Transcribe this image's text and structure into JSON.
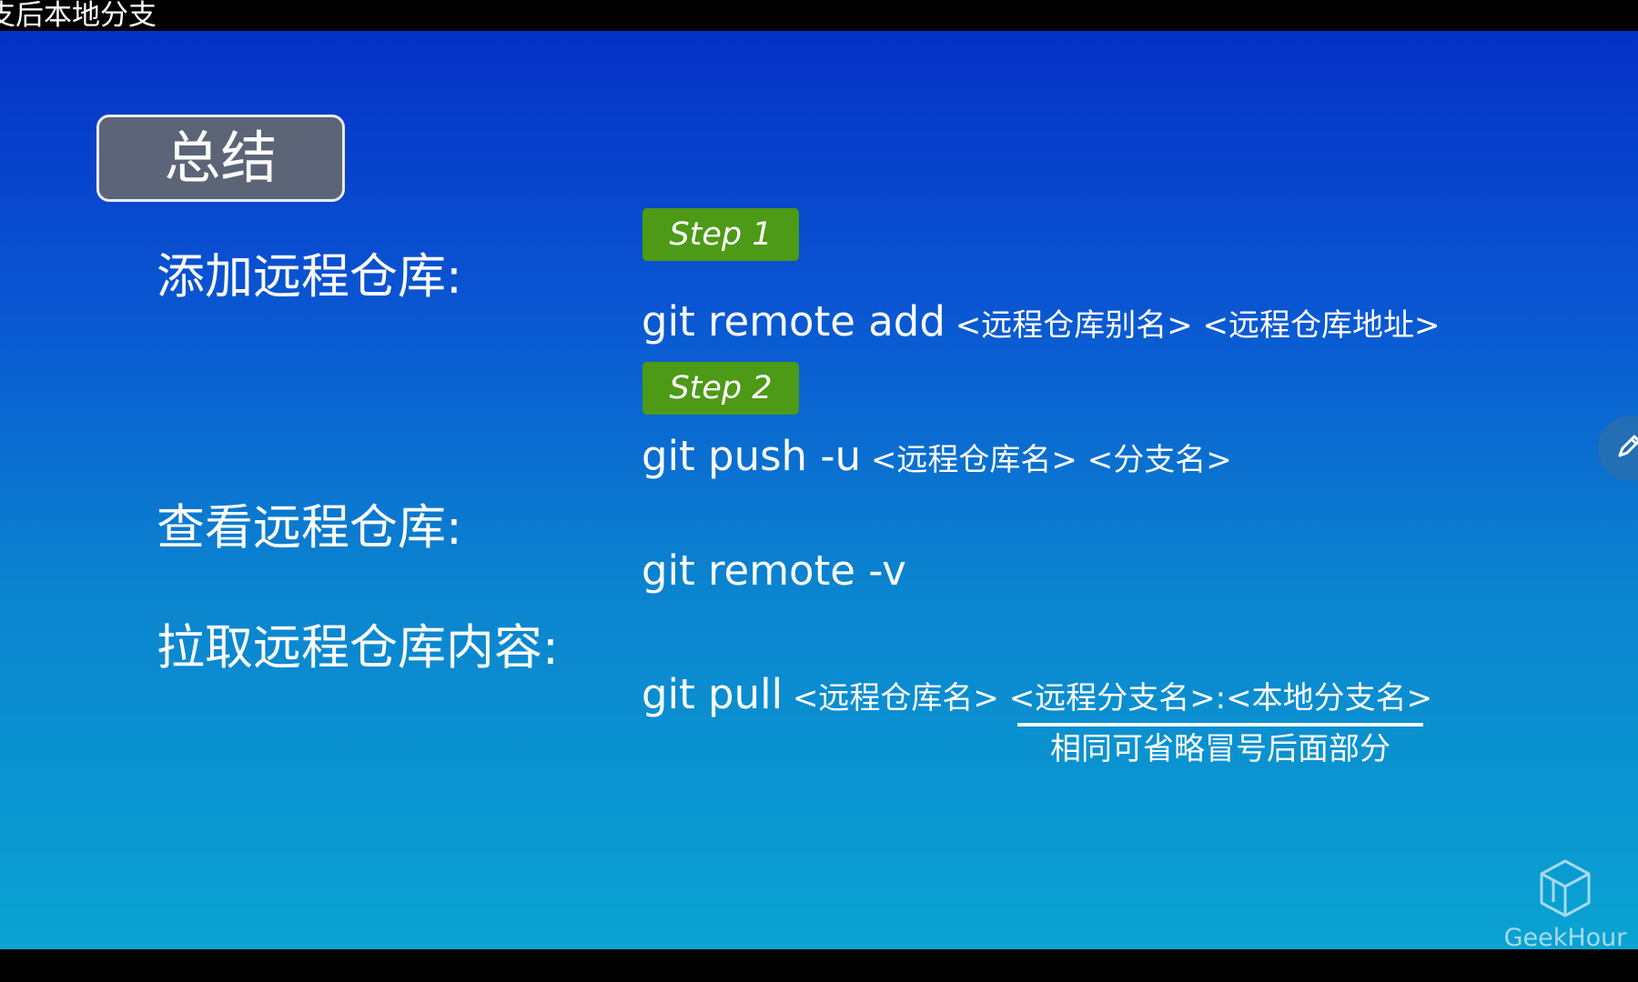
{
  "video": {
    "title": "支后本地分支"
  },
  "slide": {
    "summary_title": "总结",
    "rows": [
      {
        "label": "添加远程仓库:",
        "steps": [
          {
            "badge": "Step 1",
            "command": "git remote add",
            "args": " <远程仓库别名> <远程仓库地址>"
          },
          {
            "badge": "Step 2",
            "command": "git push -u",
            "args": " <远程仓库名> <分支名>"
          }
        ]
      },
      {
        "label": "查看远程仓库:",
        "command": "git remote -v"
      },
      {
        "label": "拉取远程仓库内容:",
        "command": "git pull",
        "args": " <远程仓库名> <远程分支名>:<本地分支名>",
        "note": "相同可省略冒号后面部分"
      }
    ]
  },
  "watermark": {
    "text": "GeekHour",
    "icon": "cube-logo-icon"
  },
  "tools": {
    "pen_icon": "pen-icon"
  },
  "colors": {
    "slide_top": "#0431c6",
    "slide_bottom": "#0aa3d2",
    "summary_box": "#5b6577",
    "step_badge": "#4c9a16",
    "text": "#ffffff"
  }
}
